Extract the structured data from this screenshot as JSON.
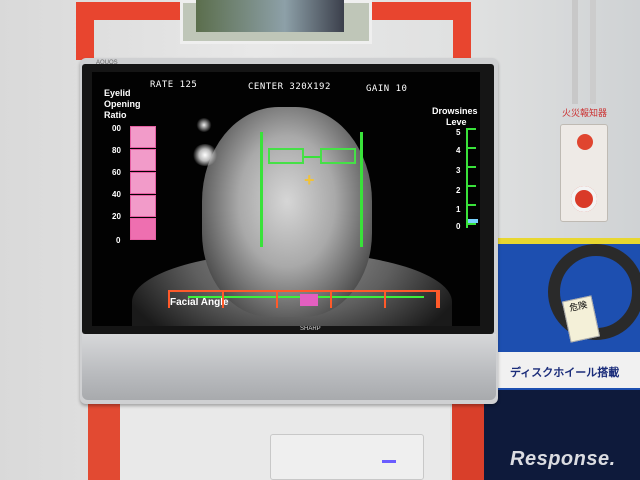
{
  "screen": {
    "rate": "RATE 125",
    "center": "CENTER 320X192",
    "gain": "GAIN 10",
    "left_label": [
      "Eyelid",
      "Opening",
      "Ratio"
    ],
    "left_ticks": [
      "00",
      "80",
      "60",
      "40",
      "20",
      "0"
    ],
    "right_label": [
      "Drowsines",
      "Leve"
    ],
    "right_ticks": [
      "5",
      "4",
      "3",
      "2",
      "1",
      "0"
    ],
    "bottom_label": "Facial Angle",
    "eyelid_ratio_percent": 100,
    "drowsiness_level": 0
  },
  "monitor": {
    "brand_top": "AQUOS",
    "brand_bottom": "SHARP"
  },
  "scene": {
    "alarm_label": "火災報知器",
    "case_banner": "ディスクホイール搭載",
    "tag_text": "危険",
    "watermark": "Response."
  },
  "colors": {
    "green": "#39e23a",
    "pink": "#ee6fb0",
    "orange": "#ff5a2a",
    "red_frame": "#e8452f"
  }
}
